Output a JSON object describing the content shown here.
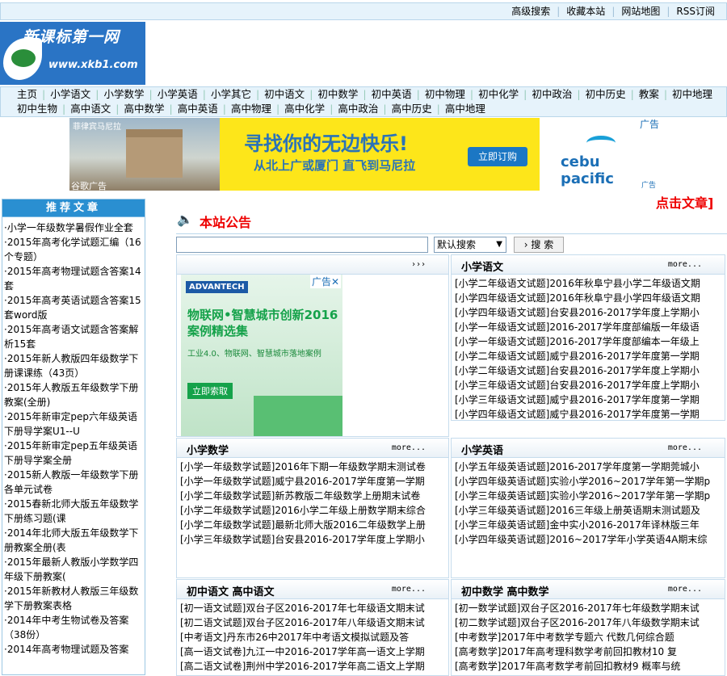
{
  "topbar": {
    "links": [
      "高级搜索",
      "收藏本站",
      "网站地图",
      "RSS订阅"
    ]
  },
  "logo": {
    "title": "新课标第一网",
    "url": "www.xkb1.com"
  },
  "nav": {
    "row1": [
      "主页",
      "小学语文",
      "小学数学",
      "小学英语",
      "小学其它",
      "初中语文",
      "初中数学",
      "初中英语",
      "初中物理",
      "初中化学",
      "初中政治",
      "初中历史",
      "教案",
      "初中地理"
    ],
    "row2": [
      "初中生物",
      "高中语文",
      "高中数学",
      "高中英语",
      "高中物理",
      "高中化学",
      "高中政治",
      "高中历史",
      "高中地理"
    ]
  },
  "banner": {
    "caption_top": "菲律宾马尼拉",
    "caption_bottom": "谷歌广告",
    "headline": "寻找你的无边快乐!",
    "sub": "从北上广或厦门 直飞到马尼拉",
    "button": "立即订购",
    "brand": "cebu pacific",
    "ad_label": "广告",
    "ad_label_small": "广告"
  },
  "sidebar": {
    "title": "推荐文章",
    "items": [
      "·小学一年级数学暑假作业全套",
      "·2015年高考化学试题汇编（16个专题）",
      "·2015年高考物理试题含答案14套",
      "·2015年高考英语试题含答案15套word版",
      "·2015年高考语文试题含答案解析15套",
      "·2015年新人教版四年级数学下册课课练（43页）",
      "·2015年人教版五年级数学下册教案(全册)",
      "·2015年新审定pep六年级英语下册导学案U1--U",
      "·2015年新审定pep五年级英语下册导学案全册",
      "·2015新人教版一年级数学下册各单元试卷",
      "·2015春新北师大版五年级数学下册练习题(课",
      "·2014年北师大版五年级数学下册教案全册(表",
      "·2015年最新人教版小学数学四年级下册教案(",
      "·2015年新教材人教版三年级数学下册教案表格",
      "·2014年中考生物试卷及答案（38份）",
      "·2014年高考物理试题及答案"
    ]
  },
  "notice": {
    "title": "本站公告",
    "marquee": "点击文章]"
  },
  "search": {
    "placeholder": "",
    "select": "默认搜索",
    "button": "搜 索"
  },
  "boxes": {
    "ad_box": {
      "more": "›››",
      "ad": {
        "brand": "ADVANTECH",
        "label": "广告✕",
        "headline": "物联网•智慧城市创新2016案例精选集",
        "para": "工业4.0、物联网、智慧城市落地案例",
        "button": "立即索取"
      }
    },
    "xiaoyu": {
      "title": "小学语文",
      "more": "more...",
      "items": [
        "[小学二年级语文试题]2016年秋阜宁县小学二年级语文期",
        "[小学四年级语文试题]2016年秋阜宁县小学四年级语文期",
        "[小学四年级语文试题]台安县2016-2017学年度上学期小",
        "[小学一年级语文试题]2016-2017学年度部编版一年级语",
        "[小学一年级语文试题]2016-2017学年度部编本一年级上",
        "[小学二年级语文试题]威宁县2016-2017学年度第一学期",
        "[小学二年级语文试题]台安县2016-2017学年度上学期小",
        "[小学三年级语文试题]台安县2016-2017学年度上学期小",
        "[小学三年级语文试题]威宁县2016-2017学年度第一学期",
        "[小学四年级语文试题]威宁县2016-2017学年度第一学期"
      ]
    },
    "xiaoshu": {
      "title": "小学数学",
      "more": "more...",
      "items": [
        "[小学一年级数学试题]2016年下期一年级数学期末测试卷",
        "[小学一年级数学试题]威宁县2016-2017学年度第一学期",
        "[小学二年级数学试题]新苏教版二年级数学上册期末试卷",
        "[小学二年级数学试题]2016小学二年级上册数学期末综合",
        "[小学二年级数学试题]最新北师大版2016二年级数学上册",
        "[小学三年级数学试题]台安县2016-2017学年度上学期小"
      ]
    },
    "xiaoying": {
      "title": "小学英语",
      "more": "more...",
      "items": [
        "[小学五年级英语试题]2016-2017学年度第一学期莞城小",
        "[小学四年级英语试题]实验小学2016~2017学年第一学期p",
        "[小学三年级英语试题]实验小学2016~2017学年第一学期p",
        "[小学三年级英语试题]2016三年级上册英语期末测试题及",
        "[小学三年级英语试题]金中实小2016-2017年译林版三年",
        "[小学四年级英语试题]2016~2017学年小学英语4A期末综"
      ]
    },
    "zhongyu": {
      "title": "初中语文  高中语文",
      "more": "more...",
      "items": [
        "[初一语文试题]双台子区2016-2017年七年级语文期末试",
        "[初二语文试题]双台子区2016-2017年八年级语文期末试",
        "[中考语文]丹东市26中2017年中考语文模拟试题及答",
        "[高一语文试卷]九江一中2016-2017学年高一语文上学期",
        "[高二语文试卷]荆州中学2016-2017学年高二语文上学期"
      ]
    },
    "zhongshu": {
      "title": "初中数学  高中数学",
      "more": "more...",
      "items": [
        "[初一数学试题]双台子区2016-2017年七年级数学期末试",
        "[初二数学试题]双台子区2016-2017年八年级数学期末试",
        "[中考数学]2017年中考数学专题六 代数几何综合题",
        "[高考数学]2017年高考理科数学考前回扣教材10 复",
        "[高考数学]2017年高考数学考前回扣教材9 概率与统"
      ]
    }
  }
}
